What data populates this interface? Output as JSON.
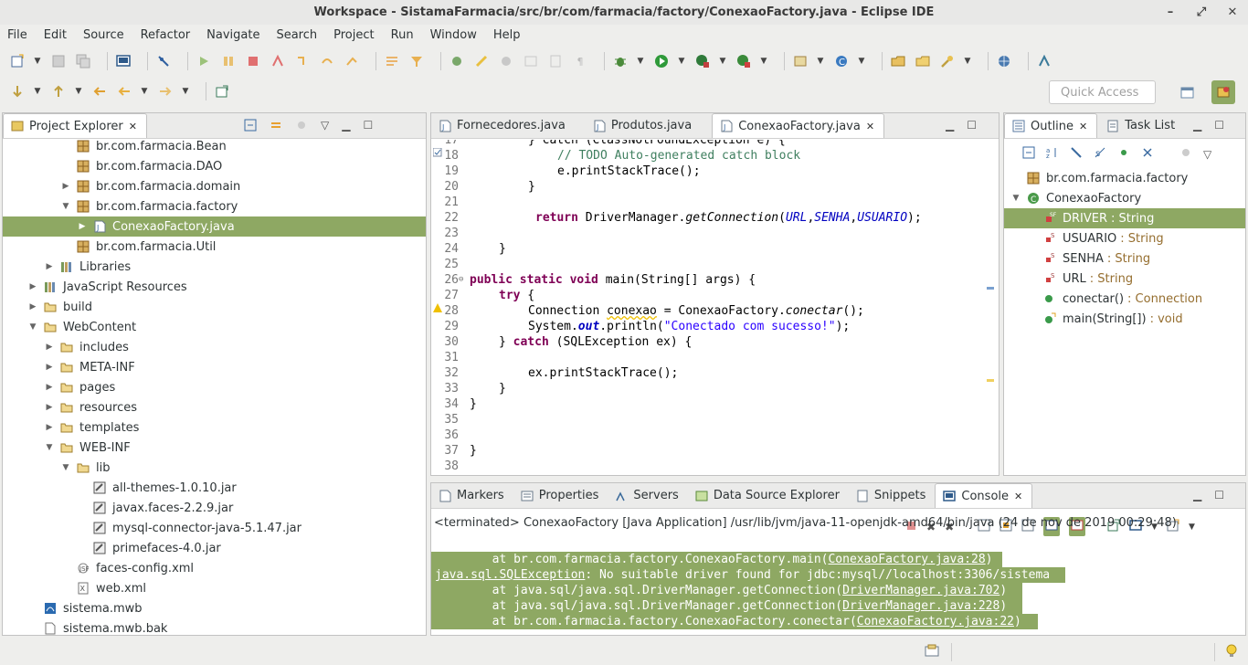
{
  "window": {
    "title": "Workspace - SistamaFarmacia/src/br/com/farmacia/factory/ConexaoFactory.java - Eclipse IDE",
    "minimize": "–",
    "maximize": "⤢",
    "close": "✕"
  },
  "menu": [
    "File",
    "Edit",
    "Source",
    "Refactor",
    "Navigate",
    "Search",
    "Project",
    "Run",
    "Window",
    "Help"
  ],
  "quick_access": {
    "placeholder": "Quick Access"
  },
  "project_explorer": {
    "tab": "Project Explorer",
    "items": [
      {
        "label": "br.com.farmacia.Bean",
        "icon": "package-icon"
      },
      {
        "label": "br.com.farmacia.DAO",
        "icon": "package-icon"
      },
      {
        "label": "br.com.farmacia.domain",
        "icon": "package-icon"
      },
      {
        "label": "br.com.farmacia.factory",
        "icon": "package-icon"
      },
      {
        "label": "ConexaoFactory.java",
        "icon": "java-file-icon"
      },
      {
        "label": "br.com.farmacia.Util",
        "icon": "package-icon"
      },
      {
        "label": "Libraries",
        "icon": "library-icon"
      },
      {
        "label": "JavaScript Resources",
        "icon": "js-resources-icon"
      },
      {
        "label": "build",
        "icon": "folder-icon"
      },
      {
        "label": "WebContent",
        "icon": "folder-icon"
      },
      {
        "label": "includes",
        "icon": "folder-icon"
      },
      {
        "label": "META-INF",
        "icon": "folder-icon"
      },
      {
        "label": "pages",
        "icon": "folder-icon"
      },
      {
        "label": "resources",
        "icon": "folder-icon"
      },
      {
        "label": "templates",
        "icon": "folder-icon"
      },
      {
        "label": "WEB-INF",
        "icon": "folder-icon"
      },
      {
        "label": "lib",
        "icon": "folder-icon"
      },
      {
        "label": "all-themes-1.0.10.jar",
        "icon": "jar-icon"
      },
      {
        "label": "javax.faces-2.2.9.jar",
        "icon": "jar-icon"
      },
      {
        "label": "mysql-connector-java-5.1.47.jar",
        "icon": "jar-icon"
      },
      {
        "label": "primefaces-4.0.jar",
        "icon": "jar-icon"
      },
      {
        "label": "faces-config.xml",
        "icon": "faces-config-icon"
      },
      {
        "label": "web.xml",
        "icon": "xml-file-icon"
      },
      {
        "label": "sistema.mwb",
        "icon": "mwb-file-icon"
      },
      {
        "label": "sistema.mwb.bak",
        "icon": "file-icon"
      }
    ]
  },
  "editor": {
    "tabs": [
      "Fornecedores.java",
      "Produtos.java",
      "ConexaoFactory.java"
    ],
    "line_numbers": [
      "17",
      "18",
      "19",
      "20",
      "21",
      "22",
      "23",
      "24",
      "25",
      "26",
      "27",
      "28",
      "29",
      "30",
      "31",
      "32",
      "33",
      "34",
      "35",
      "36",
      "37",
      "38"
    ],
    "code": {
      "l17": "} catch (ClassNotFoundException e) {",
      "l18": "// TODO Auto-generated catch block",
      "l19": "e.printStackTrace();",
      "l20": "}",
      "l22_kw": "return",
      "l22_a": " DriverManager.",
      "l22_m": "getConnection",
      "l22_b": "(",
      "l22_f1": "URL",
      "l22_f2": "SENHA",
      "l22_f3": "USUARIO",
      "l22_c": ");",
      "l24": "}",
      "l26_kw": "public static void",
      "l26_rest": " main(String[] args) {",
      "l27_kw": "try",
      "l27_rest": " {",
      "l28_a": "Connection ",
      "l28_var": "conexao",
      "l28_b": " = ConexaoFactory.",
      "l28_m": "conectar",
      "l28_c": "();",
      "l29_a": "System.",
      "l29_out": "out",
      "l29_b": ".println(",
      "l29_s": "\"Conectado com sucesso!\"",
      "l29_c": ");",
      "l30_a": "} ",
      "l30_kw": "catch",
      "l30_b": " (SQLException ex) {",
      "l32": "ex.printStackTrace();",
      "l33": "}",
      "l34": "}",
      "l37": "}"
    }
  },
  "outline": {
    "tabs": [
      "Outline",
      "Task List"
    ],
    "items": [
      {
        "label": "br.com.farmacia.factory",
        "type": ""
      },
      {
        "label": "ConexaoFactory",
        "type": ""
      },
      {
        "label": "DRIVER",
        "type": ": String"
      },
      {
        "label": "USUARIO",
        "type": ": String"
      },
      {
        "label": "SENHA",
        "type": ": String"
      },
      {
        "label": "URL",
        "type": ": String"
      },
      {
        "label": "conectar()",
        "type": ": Connection"
      },
      {
        "label": "main(String[])",
        "type": ": void"
      }
    ]
  },
  "console": {
    "tabs": [
      "Markers",
      "Properties",
      "Servers",
      "Data Source Explorer",
      "Snippets",
      "Console"
    ],
    "terminated": "<terminated> ConexaoFactory [Java Application] /usr/lib/jvm/java-11-openjdk-amd64/bin/java (24 de nov de 2019 00:29:48)",
    "lines": [
      {
        "pre": "        at br.com.farmacia.factory.ConexaoFactory.main(",
        "link": "ConexaoFactory.java:28",
        "post": ")"
      },
      {
        "pre": "",
        "link": "java.sql.SQLException",
        "post": ": No suitable driver found for jdbc:mysql//localhost:3306/sistema"
      },
      {
        "pre": "        at java.sql/java.sql.DriverManager.getConnection(",
        "link": "DriverManager.java:702",
        "post": ")"
      },
      {
        "pre": "        at java.sql/java.sql.DriverManager.getConnection(",
        "link": "DriverManager.java:228",
        "post": ")"
      },
      {
        "pre": "        at br.com.farmacia.factory.ConexaoFactory.conectar(",
        "link": "ConexaoFactory.java:22",
        "post": ")"
      }
    ]
  },
  "colors": {
    "selection": "#8ea863",
    "keyword": "#7f0055",
    "comment": "#3f7f5f",
    "string": "#2a00ff",
    "field": "#0000c0"
  }
}
